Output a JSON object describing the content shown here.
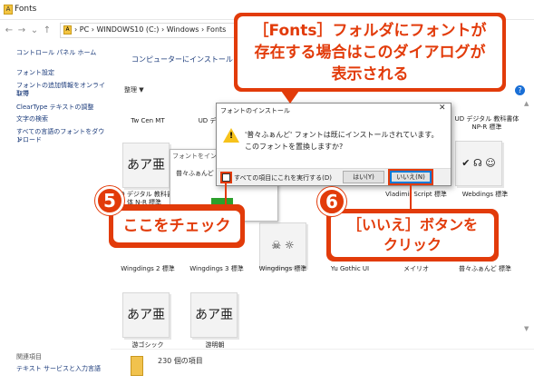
{
  "window": {
    "title": "Fonts"
  },
  "address": {
    "crumbs": [
      "PC",
      "WINDOWS10 (C:)",
      "Windows",
      "Fonts"
    ]
  },
  "sidebar": {
    "items": [
      "コントロール パネル ホーム",
      "フォント設定",
      "フォントの追加情報をオンラインで",
      "取得",
      "ClearType テキストの調整",
      "文字の検索",
      "すべての言語のフォントをダウンロード",
      "ド"
    ],
    "related_title": "関連項目",
    "related_link": "テキスト サービスと入力言語"
  },
  "main": {
    "header_text": "コンピューターにインストールされ",
    "organize_label": "整理 ▼",
    "help_icon": "?",
    "fonts": [
      {
        "name": "Tw Cen MT",
        "preview": ""
      },
      {
        "name": "UD デジタル",
        "preview": ""
      },
      {
        "name": "UD デジタル 教科書体 NP-R 標準",
        "preview": ""
      },
      {
        "name": "UD デジタル 教科書体 N-R 標準",
        "preview": ""
      },
      {
        "name": "Vladimir Script 標準",
        "preview": ""
      },
      {
        "name": "Webdings 標準",
        "preview": "✔ ☊ ☺"
      },
      {
        "name": "Wingdings 2 標準",
        "preview": ""
      },
      {
        "name": "Wingdings 3 標準",
        "preview": ""
      },
      {
        "name": "Wingdings 標準",
        "preview": ""
      },
      {
        "name": "Yu Gothic UI",
        "preview": ""
      },
      {
        "name": "メイリオ",
        "preview": ""
      },
      {
        "name": "普々ふぁんど 標準",
        "preview": ""
      },
      {
        "name": "游ゴシック",
        "preview": "あア亜"
      },
      {
        "name": "游明朝",
        "preview": "あア亜"
      },
      {
        "name": "体",
        "preview": ""
      },
      {
        "name": "",
        "preview": "あア亜"
      }
    ]
  },
  "status": {
    "count": "230 個の項目"
  },
  "back_dialog": {
    "title": "フォントをインス",
    "text": "普々ふぁんど 標"
  },
  "dialog": {
    "title": "フォントのインストール",
    "close": "✕",
    "message_line1": "'普々ふぁんど' フォントは既にインストールされています。",
    "message_line2": "このフォントを置換しますか?",
    "checkbox_label": "すべての項目にこれを実行する(D)",
    "yes_label": "はい(Y)",
    "no_label": "いいえ(N)"
  },
  "annotations": {
    "top_callout_line1": "［Fonts］フォルダにフォントが",
    "top_callout_line2": "存在する場合はこのダイアログが",
    "top_callout_line3": "表示される",
    "step5_number": "5",
    "step5_text": "ここをチェック",
    "step6_number": "6",
    "step6_line1": "［いいえ］ボタンを",
    "step6_line2": "クリック"
  },
  "colors": {
    "accent": "#e23b0a",
    "link": "#1a3a7a",
    "folder": "#f1c24d",
    "progress": "#2ca02c"
  }
}
